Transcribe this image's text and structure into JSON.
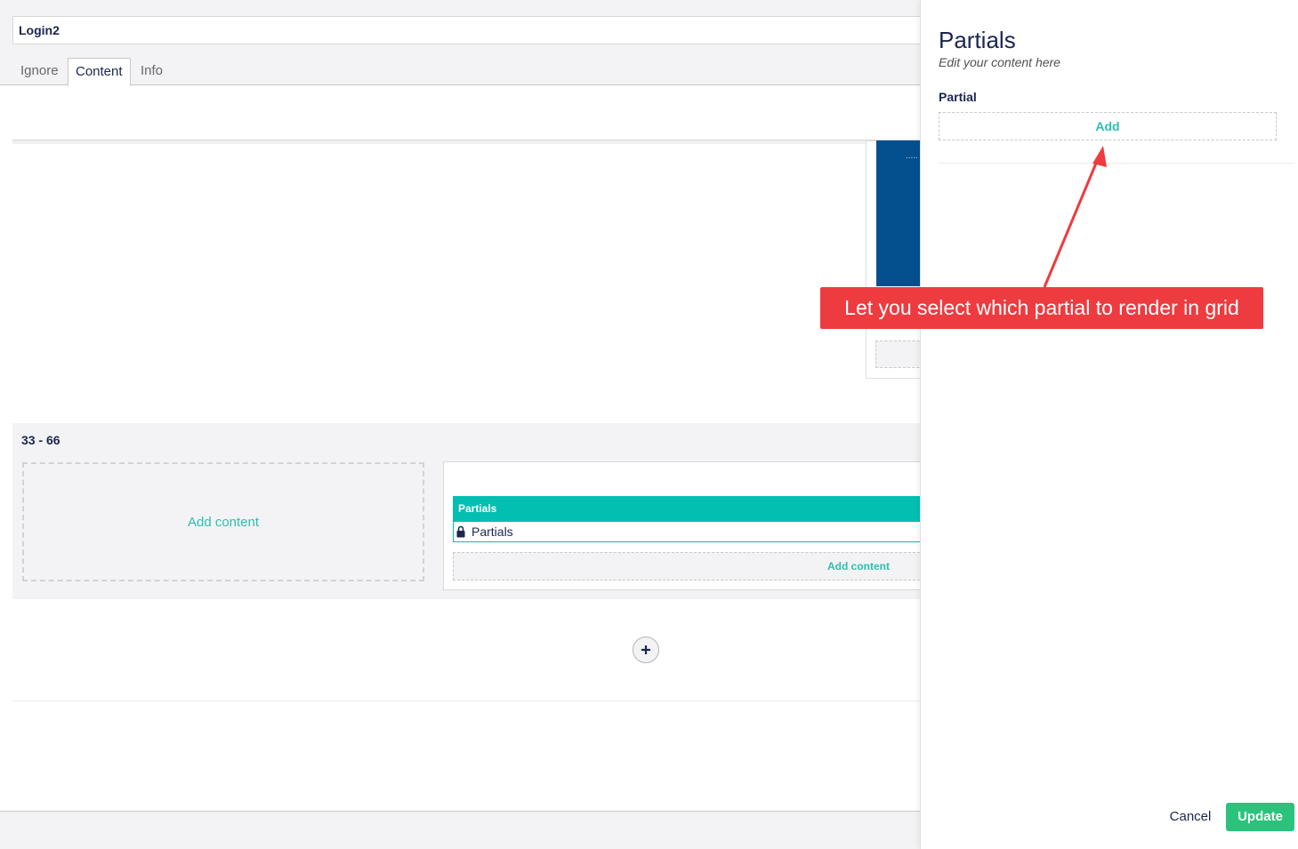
{
  "editor": {
    "name_value": "Login2",
    "tabs": [
      {
        "label": "Ignore",
        "active": false
      },
      {
        "label": "Content",
        "active": true
      },
      {
        "label": "Info",
        "active": false
      }
    ]
  },
  "grid": {
    "row_label": "33 - 66",
    "left_cell_add_label": "Add content",
    "right_cell": {
      "editor_header": "Partials",
      "item_label": "Partials",
      "add_content_label": "Add content"
    },
    "add_row_icon": "plus-icon"
  },
  "panel": {
    "title": "Partials",
    "subtitle": "Edit your content here",
    "field_label": "Partial",
    "add_label": "Add",
    "cancel_label": "Cancel",
    "update_label": "Update"
  },
  "annotation": {
    "text": "Let you select which partial to render in grid"
  },
  "colors": {
    "accent": "#03bfb1",
    "update_green": "#2bc37c",
    "annotation_red": "#ee3b3f",
    "preview_blue": "#04508f"
  }
}
